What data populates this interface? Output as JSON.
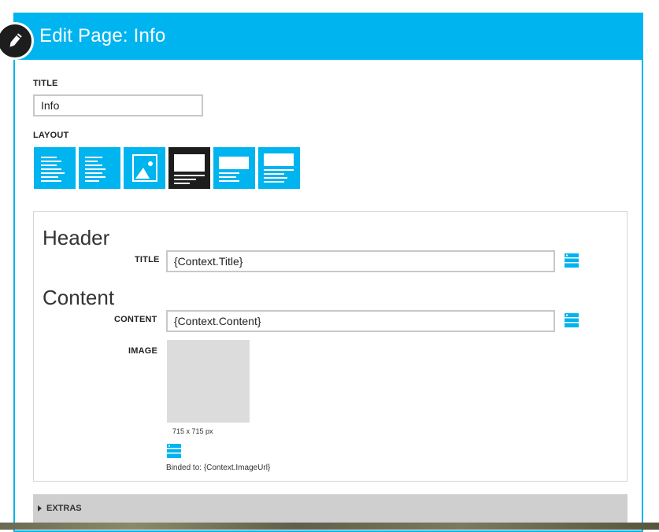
{
  "window": {
    "title": "Edit Page: Info"
  },
  "page_title": {
    "label": "TITLE",
    "value": "Info"
  },
  "layout": {
    "label": "LAYOUT",
    "options": [
      {
        "name": "text-left"
      },
      {
        "name": "text-indented"
      },
      {
        "name": "image-only"
      },
      {
        "name": "header-image-text",
        "selected": true
      },
      {
        "name": "image-text-small"
      },
      {
        "name": "image-text-wide"
      }
    ]
  },
  "header_section": {
    "heading": "Header",
    "title_label": "TITLE",
    "title_value": "{Context.Title}"
  },
  "content_section": {
    "heading": "Content",
    "content_label": "CONTENT",
    "content_value": "{Context.Content}",
    "image_label": "IMAGE",
    "image_size": "715 x 715 px",
    "image_binding": "Binded to: {Context.ImageUrl}"
  },
  "extras": {
    "label": "EXTRAS"
  },
  "colors": {
    "accent": "#00b4ef",
    "selected_tile": "#1d1d1d",
    "placeholder": "#dcdcdc"
  },
  "icons": {
    "edit": "pencil-icon",
    "bind": "data-binding-icon",
    "expand": "triangle-right-icon"
  }
}
